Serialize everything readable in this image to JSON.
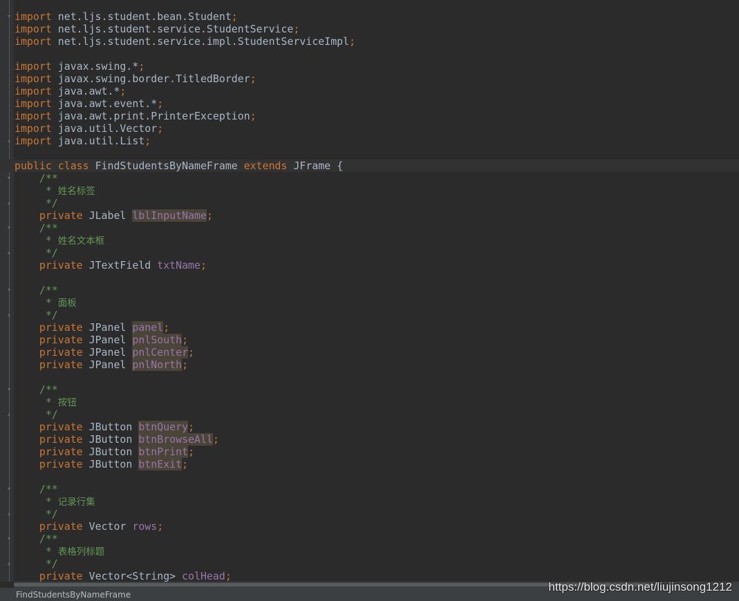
{
  "editor": {
    "file_name": "FindStudentsByNameFrame",
    "watermark": "https://blog.csdn.net/liujinsong1212",
    "kw": {
      "import": "import",
      "public": "public",
      "class": "class",
      "extends": "extends",
      "private": "private"
    },
    "imports": [
      "net.ljs.student.bean.Student",
      "net.ljs.student.service.StudentService",
      "net.ljs.student.service.impl.StudentServiceImpl",
      "javax.swing.*",
      "javax.swing.border.TitledBorder",
      "java.awt.*",
      "java.awt.event.*",
      "java.awt.print.PrinterException",
      "java.util.Vector",
      "java.util.List"
    ],
    "class_name": "FindStudentsByNameFrame",
    "super_class": "JFrame",
    "comments": {
      "open": "/**",
      "close": "*/",
      "star": "* ",
      "last_open": "/**",
      "c1": "姓名标签",
      "c2": "姓名文本框",
      "c3": "面板",
      "c4": "按钮",
      "c5": "记录行集",
      "c6": "表格列标题"
    },
    "types": {
      "jlabel": "JLabel",
      "jtextfield": "JTextField",
      "jpanel": "JPanel",
      "jbutton": "JButton",
      "vector": "Vector",
      "vector_string": "Vector<String>"
    },
    "fields": {
      "lblInputName": "lblInputName",
      "txtName": "txtName",
      "panel": "panel",
      "pnlSouth": "pnlSouth",
      "pnlCenter": "pnlCenter",
      "pnlNorth": "pnlNorth",
      "btnQuery": "btnQuery",
      "btnBrowseAll": "btnBrowseAll",
      "btnPrint": "btnPrint",
      "btnExit": "btnExit",
      "rows": "rows",
      "colHead": "colHead"
    },
    "punct": {
      "semi": ";",
      "brace": "{"
    }
  }
}
